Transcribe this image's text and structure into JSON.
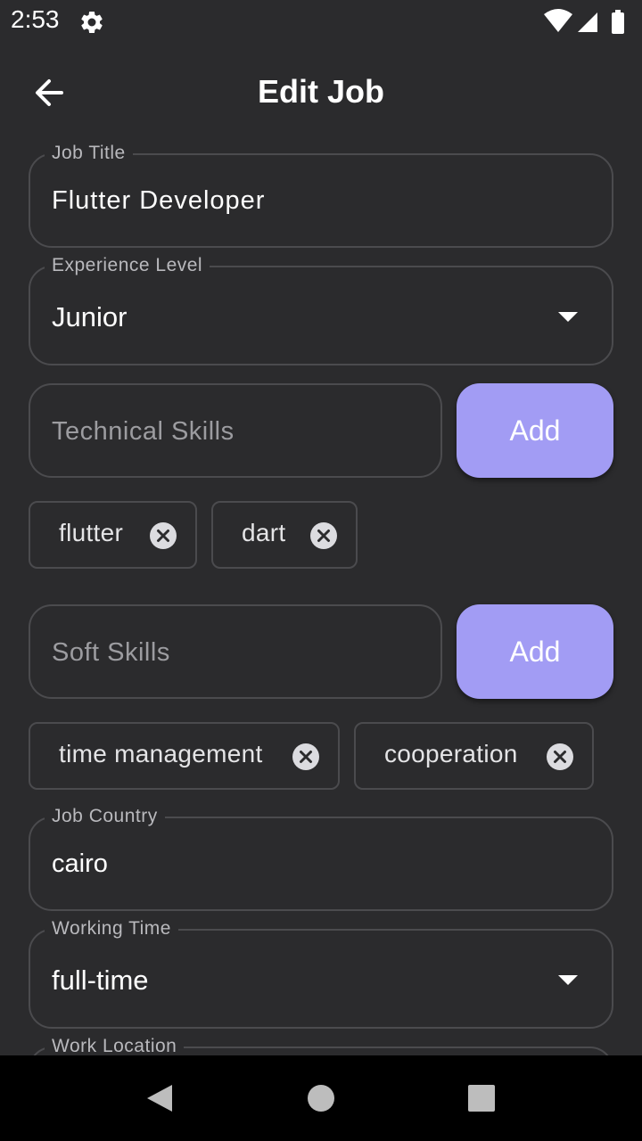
{
  "status": {
    "time": "2:53"
  },
  "app_bar": {
    "title": "Edit Job"
  },
  "form": {
    "job_title": {
      "label": "Job Title",
      "value": "Flutter Developer"
    },
    "experience_level": {
      "label": "Experience Level",
      "value": "Junior"
    },
    "technical_skills": {
      "placeholder": "Technical Skills",
      "add_label": "Add",
      "chips": [
        "flutter",
        "dart"
      ]
    },
    "soft_skills": {
      "placeholder": "Soft Skills",
      "add_label": "Add",
      "chips": [
        "time management",
        "cooperation"
      ]
    },
    "job_country": {
      "label": "Job Country",
      "value": "cairo"
    },
    "working_time": {
      "label": "Working Time",
      "value": "full-time"
    },
    "work_location": {
      "label": "Work Location"
    }
  },
  "icons": {
    "settings": "gear-icon",
    "wifi": "wifi-icon",
    "signal": "signal-icon",
    "battery": "battery-icon",
    "back": "back-arrow-icon",
    "chip_remove": "close-circle-icon",
    "dropdown": "dropdown-arrow-icon",
    "nav_back": "nav-back-icon",
    "nav_home": "nav-home-icon",
    "nav_recents": "nav-recents-icon"
  },
  "colors": {
    "background": "#2b2b2d",
    "accent": "#a29cf4",
    "outline": "#4b4b4e"
  }
}
